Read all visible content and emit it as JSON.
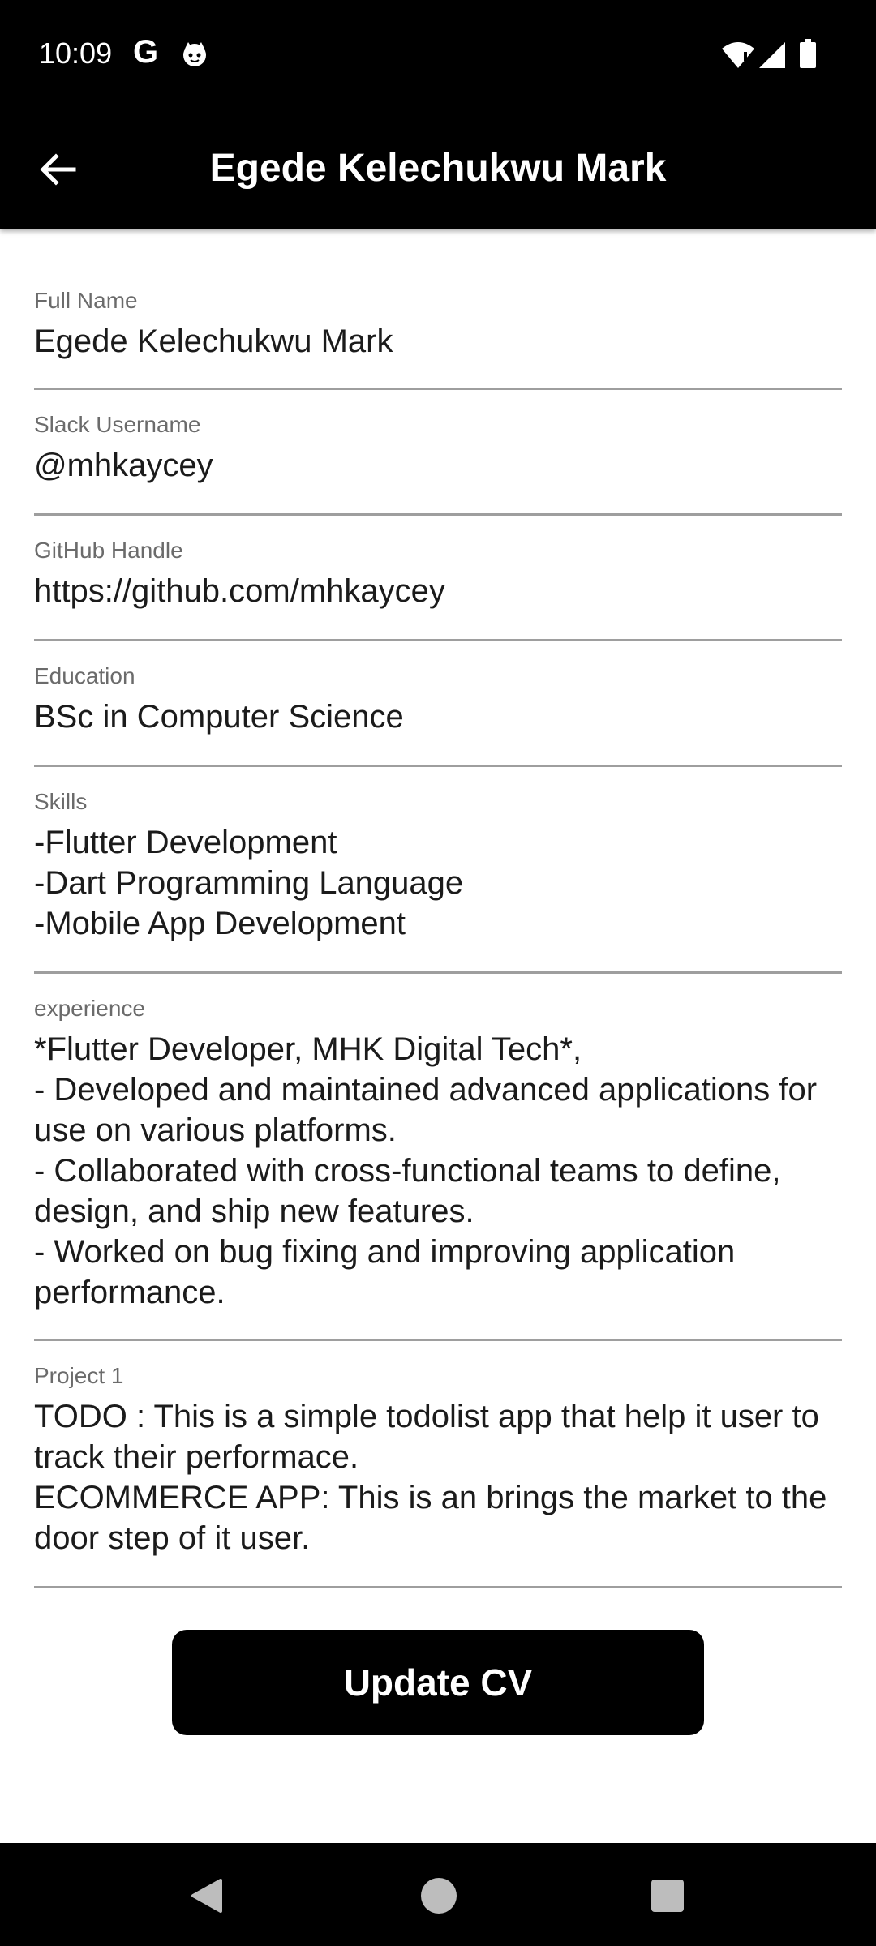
{
  "status_bar": {
    "time": "10:09",
    "google_letter": "G",
    "icons": [
      "google-icon",
      "cat-icon",
      "wifi-icon",
      "signal-icon",
      "battery-icon"
    ]
  },
  "app_bar": {
    "title": "Egede Kelechukwu Mark",
    "back_icon": "arrow-back-icon"
  },
  "fields": [
    {
      "label": "Full Name",
      "value": "Egede Kelechukwu Mark"
    },
    {
      "label": "Slack Username",
      "value": "@mhkaycey"
    },
    {
      "label": "GitHub Handle",
      "value": "https://github.com/mhkaycey"
    },
    {
      "label": "Education",
      "value": "BSc in Computer Science"
    },
    {
      "label": "Skills",
      "value": "-Flutter Development\n-Dart Programming Language\n-Mobile App Development"
    },
    {
      "label": "experience",
      "value": "*Flutter Developer, MHK Digital Tech*,\n- Developed and maintained advanced applications for use on various platforms.\n- Collaborated with cross-functional teams to define, design, and ship new features.\n- Worked on bug fixing and improving application performance."
    },
    {
      "label": "Project 1",
      "value": "TODO : This is a simple todolist app that help it user to track their performace.\nECOMMERCE APP: This is an brings the market to the door step of it user."
    }
  ],
  "update_button": {
    "label": "Update CV"
  },
  "nav_bar": {
    "icons": [
      "nav-back-icon",
      "nav-home-icon",
      "nav-recents-icon"
    ]
  },
  "colors": {
    "bar_background": "#000000",
    "field_underline": "#9e9e9e",
    "label_text": "#6b6b6b"
  }
}
